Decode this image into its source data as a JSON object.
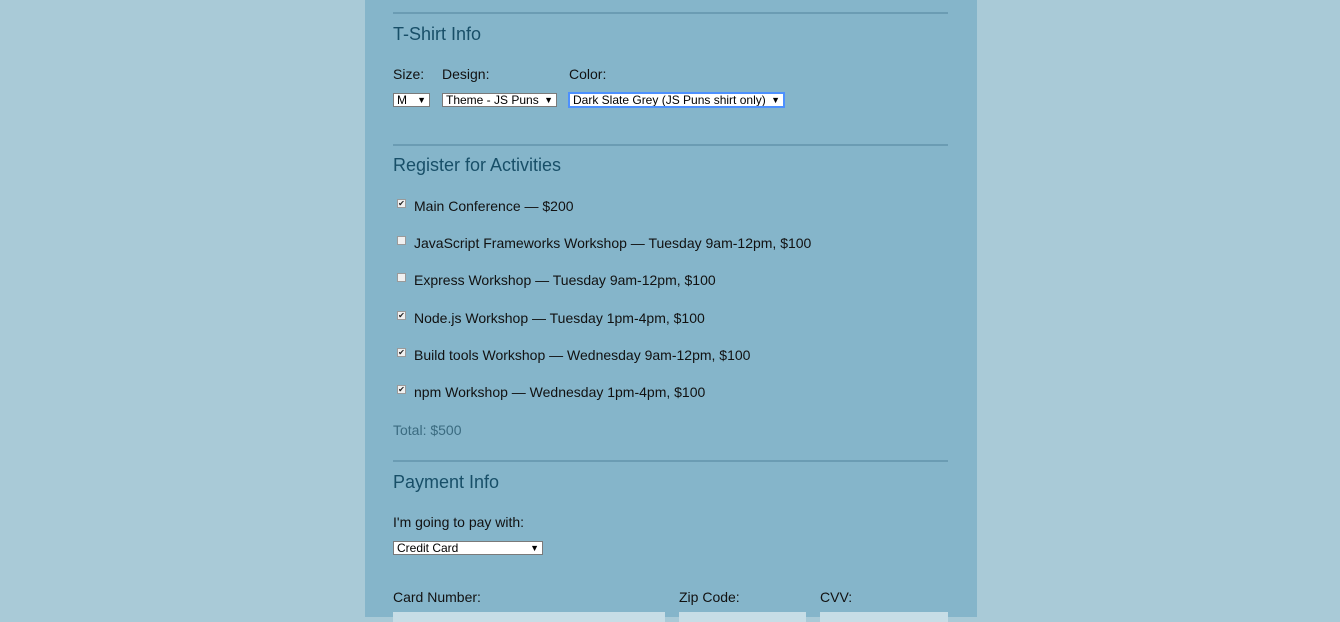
{
  "tshirt": {
    "title": "T-Shirt Info",
    "size": {
      "label": "Size:",
      "value": "M"
    },
    "design": {
      "label": "Design:",
      "value": "Theme - JS Puns"
    },
    "color": {
      "label": "Color:",
      "value": "Dark Slate Grey (JS Puns shirt only)"
    }
  },
  "activities": {
    "title": "Register for Activities",
    "items": [
      {
        "label": "Main Conference — $200",
        "checked": true
      },
      {
        "label": "JavaScript Frameworks Workshop — Tuesday 9am-12pm, $100",
        "checked": false
      },
      {
        "label": "Express Workshop — Tuesday 9am-12pm, $100",
        "checked": false
      },
      {
        "label": "Node.js Workshop — Tuesday 1pm-4pm, $100",
        "checked": true
      },
      {
        "label": "Build tools Workshop — Wednesday 9am-12pm, $100",
        "checked": true
      },
      {
        "label": "npm Workshop — Wednesday 1pm-4pm, $100",
        "checked": true
      }
    ],
    "total": "Total: $500"
  },
  "payment": {
    "title": "Payment Info",
    "method_label": "I'm going to pay with:",
    "method_value": "Credit Card",
    "card_number_label": "Card Number:",
    "zip_label": "Zip Code:",
    "cvv_label": "CVV:"
  },
  "icons": {
    "caret": "▼",
    "check": "✔"
  },
  "colors": {
    "page_bg": "#a9cad7",
    "panel_bg": "#85b5ca",
    "heading": "#184f68",
    "total_text": "#3b6b80"
  }
}
